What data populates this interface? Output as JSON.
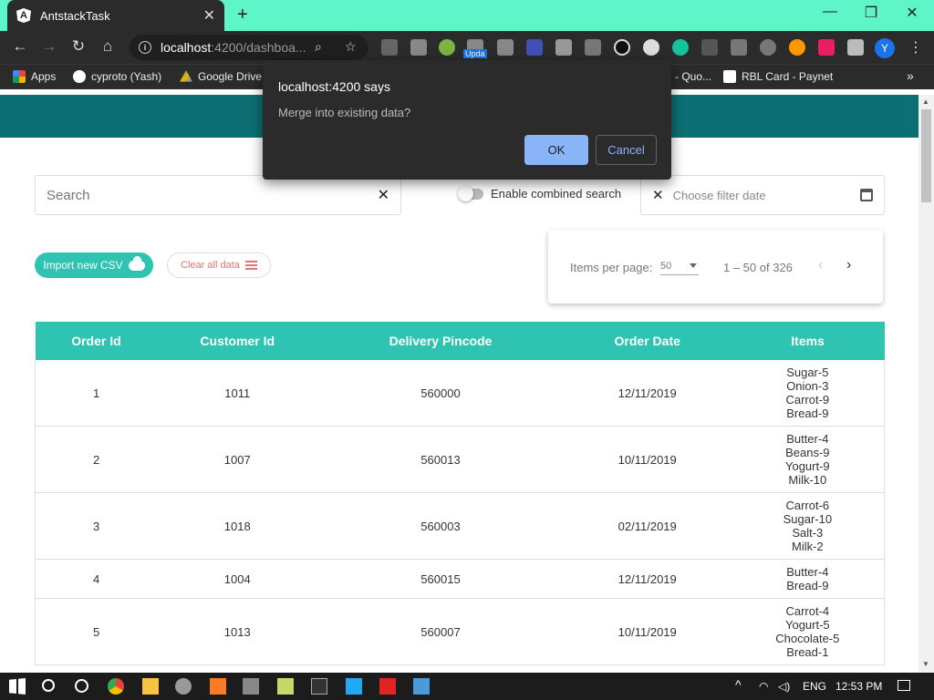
{
  "browser": {
    "tab_title": "AntstackTask",
    "tab_icon_letter": "A",
    "url_host": "localhost",
    "url_path": ":4200/dashboa...",
    "avatar_letter": "Y",
    "extension_badge": "Upda",
    "bookmarks": [
      {
        "label": "Apps",
        "color": "#e8453c"
      },
      {
        "label": "cyproto (Yash)",
        "color": "#ffffff"
      },
      {
        "label": "Google Drive",
        "color": "#f4b400"
      },
      {
        "label": "- Quo...",
        "color": "#2b2b2b"
      },
      {
        "label": "RBL Card - Paynet",
        "color": "#ffffff"
      }
    ]
  },
  "dialog": {
    "title": "localhost:4200 says",
    "message": "Merge into existing data?",
    "ok_label": "OK",
    "cancel_label": "Cancel"
  },
  "filters": {
    "search_placeholder": "Search",
    "combined_search_label": "Enable combined search",
    "date_placeholder": "Choose filter date"
  },
  "actions": {
    "import_label": "Import new CSV",
    "clear_label": "Clear all data"
  },
  "paginator": {
    "items_per_page_label": "Items per page:",
    "items_per_page_value": "50",
    "range_label": "1 – 50 of 326"
  },
  "table": {
    "headers": [
      "Order Id",
      "Customer Id",
      "Delivery Pincode",
      "Order Date",
      "Items"
    ],
    "rows": [
      {
        "order_id": "1",
        "customer_id": "1011",
        "pincode": "560000",
        "date": "12/11/2019",
        "items": [
          "Sugar-5",
          "Onion-3",
          "Carrot-9",
          "Bread-9"
        ]
      },
      {
        "order_id": "2",
        "customer_id": "1007",
        "pincode": "560013",
        "date": "10/11/2019",
        "items": [
          "Butter-4",
          "Beans-9",
          "Yogurt-9",
          "Milk-10"
        ]
      },
      {
        "order_id": "3",
        "customer_id": "1018",
        "pincode": "560003",
        "date": "02/11/2019",
        "items": [
          "Carrot-6",
          "Sugar-10",
          "Salt-3",
          "Milk-2"
        ]
      },
      {
        "order_id": "4",
        "customer_id": "1004",
        "pincode": "560015",
        "date": "12/11/2019",
        "items": [
          "Butter-4",
          "Bread-9"
        ]
      },
      {
        "order_id": "5",
        "customer_id": "1013",
        "pincode": "560007",
        "date": "10/11/2019",
        "items": [
          "Carrot-4",
          "Yogurt-5",
          "Chocolate-5",
          "Bread-1"
        ]
      }
    ]
  },
  "taskbar": {
    "language": "ENG",
    "time": "12:53 PM"
  },
  "colors": {
    "tab_strip": "#5ef5c8",
    "app_header": "#0d6f73",
    "accent": "#2ec4b1",
    "danger": "#e57373"
  }
}
